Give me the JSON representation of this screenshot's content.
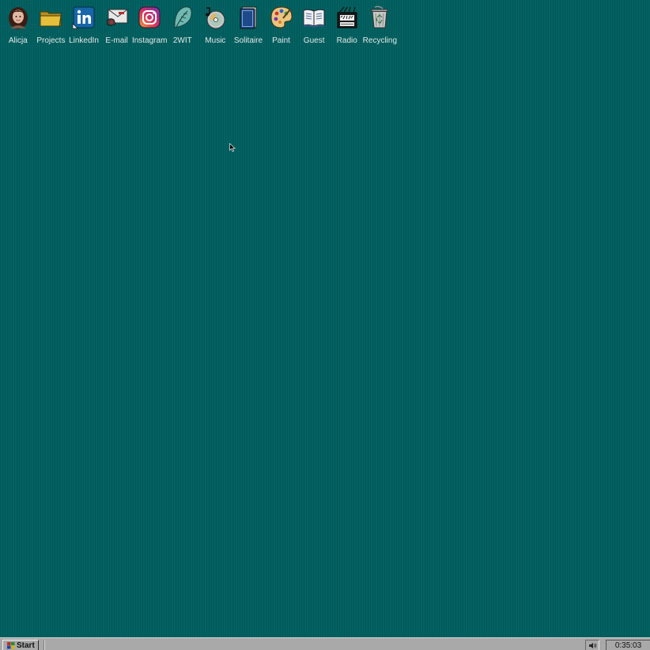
{
  "desktop": {
    "background_color": "#005e5e",
    "icons": [
      {
        "label": "Alicja",
        "icon": "user-avatar-icon"
      },
      {
        "label": "Projects",
        "icon": "folder-icon"
      },
      {
        "label": "LinkedIn",
        "icon": "linkedin-icon"
      },
      {
        "label": "E-mail",
        "icon": "email-icon"
      },
      {
        "label": "Instagram",
        "icon": "instagram-icon"
      },
      {
        "label": "2WIT",
        "icon": "feather-icon"
      },
      {
        "label": "Music",
        "icon": "cd-music-icon"
      },
      {
        "label": "Solitaire",
        "icon": "card-deck-icon"
      },
      {
        "label": "Paint",
        "icon": "paint-palette-icon"
      },
      {
        "label": "Guest",
        "icon": "guest-book-icon"
      },
      {
        "label": "Radio",
        "icon": "radio-icon"
      },
      {
        "label": "Recycling",
        "icon": "recycle-bin-icon"
      }
    ]
  },
  "taskbar": {
    "start_label": "Start",
    "clock": "0:35:03",
    "tray_icon": "speaker-icon"
  }
}
